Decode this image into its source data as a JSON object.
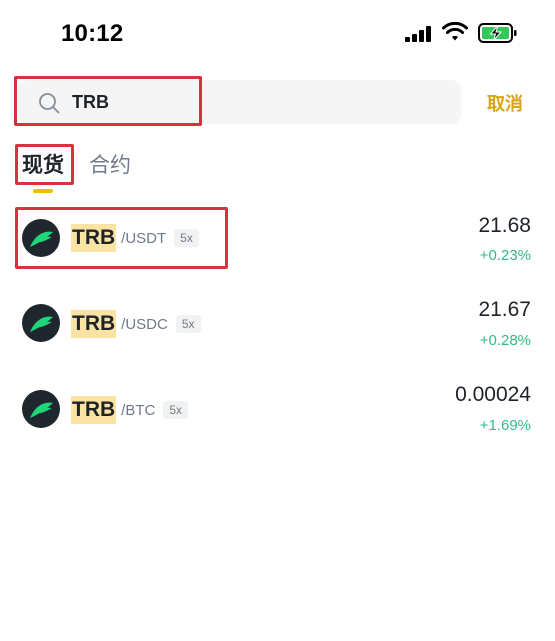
{
  "status_bar": {
    "time": "10:12"
  },
  "search": {
    "query": "TRB",
    "placeholder": "",
    "cancel_label": "取消"
  },
  "tabs": [
    {
      "label": "现货",
      "active": true
    },
    {
      "label": "合约",
      "active": false
    }
  ],
  "markets": [
    {
      "base": "TRB",
      "quote": "/USDT",
      "leverage": "5x",
      "price": "21.68",
      "change": "+0.23%"
    },
    {
      "base": "TRB",
      "quote": "/USDC",
      "leverage": "5x",
      "price": "21.67",
      "change": "+0.28%"
    },
    {
      "base": "TRB",
      "quote": "/BTC",
      "leverage": "5x",
      "price": "0.00024",
      "change": "+1.69%"
    }
  ],
  "icons": {
    "search": "search-icon",
    "coin": "trb-logo-icon",
    "signal": "cellular-signal-icon",
    "wifi": "wifi-icon",
    "battery": "battery-charging-icon"
  },
  "colors": {
    "accent": "#f0b90b",
    "cancel_text": "#d9a512",
    "positive": "#2ebd85",
    "highlight_box": "#d9323f",
    "search_match_bg": "#fbe3a4"
  }
}
